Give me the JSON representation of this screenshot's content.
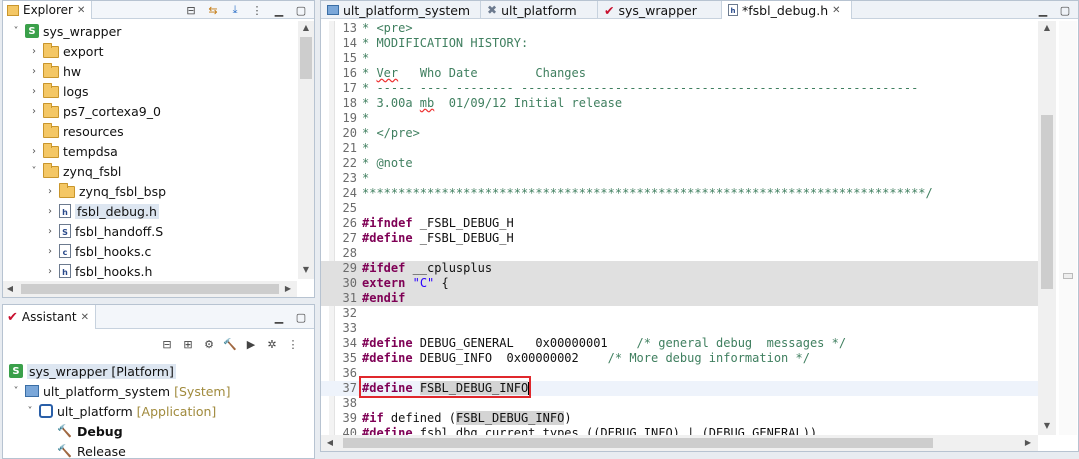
{
  "explorer": {
    "tab_label": "Explorer",
    "tree": [
      {
        "label": "sys_wrapper",
        "kind": "project",
        "twisty": "˅"
      },
      {
        "label": "export",
        "kind": "folder",
        "twisty": "›"
      },
      {
        "label": "hw",
        "kind": "folder",
        "twisty": "›"
      },
      {
        "label": "logs",
        "kind": "folder",
        "twisty": "›"
      },
      {
        "label": "ps7_cortexa9_0",
        "kind": "folder",
        "twisty": "›"
      },
      {
        "label": "resources",
        "kind": "folder",
        "twisty": ""
      },
      {
        "label": "tempdsa",
        "kind": "folder",
        "twisty": "›"
      },
      {
        "label": "zynq_fsbl",
        "kind": "folder",
        "twisty": "˅"
      },
      {
        "label": "zynq_fsbl_bsp",
        "kind": "folder",
        "twisty": "›"
      },
      {
        "label": "fsbl_debug.h",
        "kind": "file",
        "badge": "h",
        "twisty": "›"
      },
      {
        "label": "fsbl_handoff.S",
        "kind": "file",
        "badge": "S",
        "twisty": "›"
      },
      {
        "label": "fsbl_hooks.c",
        "kind": "file",
        "badge": "c",
        "twisty": "›"
      },
      {
        "label": "fsbl_hooks.h",
        "kind": "file",
        "badge": "h",
        "twisty": "›"
      }
    ]
  },
  "assistant": {
    "tab_label": "Assistant",
    "items": [
      {
        "label": "sys_wrapper [Platform]",
        "tag": ""
      },
      {
        "label": "ult_platform_system",
        "tag": "[System]"
      },
      {
        "label": "ult_platform",
        "tag": "[Application]"
      },
      {
        "label": "Debug",
        "tag": ""
      },
      {
        "label": "Release",
        "tag": ""
      }
    ]
  },
  "editor": {
    "tabs": [
      {
        "label": "ult_platform_system"
      },
      {
        "label": "ult_platform"
      },
      {
        "label": "sys_wrapper"
      },
      {
        "label": "*fsbl_debug.h"
      }
    ],
    "lines": [
      {
        "n": "13",
        "t": "* <pre>"
      },
      {
        "n": "14",
        "t": "* MODIFICATION HISTORY:"
      },
      {
        "n": "15",
        "t": "*"
      },
      {
        "n": "16",
        "t": "* Ver   Who Date        Changes"
      },
      {
        "n": "17",
        "t": "* ----- ---- -------- -------------------------------------------------------"
      },
      {
        "n": "18",
        "t": "* 3.00a mb  01/09/12 Initial release"
      },
      {
        "n": "19",
        "t": "*"
      },
      {
        "n": "20",
        "t": "* </pre>"
      },
      {
        "n": "21",
        "t": "*"
      },
      {
        "n": "22",
        "t": "* @note"
      },
      {
        "n": "23",
        "t": "*"
      },
      {
        "n": "24",
        "t": "******************************************************************************/"
      },
      {
        "n": "25",
        "t": ""
      },
      {
        "n": "26",
        "t": "#ifndef _FSBL_DEBUG_H"
      },
      {
        "n": "27",
        "t": "#define _FSBL_DEBUG_H"
      },
      {
        "n": "28",
        "t": ""
      },
      {
        "n": "29",
        "t": "#ifdef __cplusplus"
      },
      {
        "n": "30",
        "t": "extern \"C\" {"
      },
      {
        "n": "31",
        "t": "#endif"
      },
      {
        "n": "32",
        "t": ""
      },
      {
        "n": "33",
        "t": ""
      },
      {
        "n": "34",
        "t": "#define DEBUG_GENERAL   0x00000001    /* general debug  messages */"
      },
      {
        "n": "35",
        "t": "#define DEBUG_INFO  0x00000002    /* More debug information */"
      },
      {
        "n": "36",
        "t": ""
      },
      {
        "n": "37",
        "t": "#define FSBL_DEBUG_INFO"
      },
      {
        "n": "38",
        "t": ""
      },
      {
        "n": "39",
        "t": "#if defined (FSBL_DEBUG_INFO)"
      },
      {
        "n": "40",
        "t": "#define fsbl_dbg_current_types ((DEBUG_INFO) | (DEBUG_GENERAL))"
      }
    ],
    "parts": {
      "ifndef_kw": "#ifndef",
      "ifndef_rest": " _FSBL_DEBUG_H",
      "define_kw": "#define",
      "define27_rest": " _FSBL_DEBUG_H",
      "ifdef_kw": "#ifdef",
      "ifdef_rest": " __cplusplus",
      "extern_kw": "extern",
      "extern_str": "\"C\"",
      "extern_rest": " {",
      "endif_kw": "#endif",
      "l34_rest": " DEBUG_GENERAL   0x00000001    ",
      "l34_cm": "/* general debug  messages */",
      "l35_rest": " DEBUG_INFO  0x00000002    ",
      "l35_cm": "/* More debug information */",
      "l37_rest": "FSBL_DEBUG_INFO",
      "if_kw": "#if",
      "l39_a": " defined (",
      "l39_mark": "FSBL_DEBUG_INFO",
      "l39_b": ")",
      "l40_rest": " fsbl_dbg_current_types ((DEBUG_INFO) | (DEBUG_GENERAL))",
      "l16_a": "* ",
      "l16_ver": "Ver",
      "l16_b": "   Who Date        Changes",
      "l18_a": "* 3.00a ",
      "l18_mb": "mb",
      "l18_b": "  01/09/12 Initial release"
    }
  }
}
